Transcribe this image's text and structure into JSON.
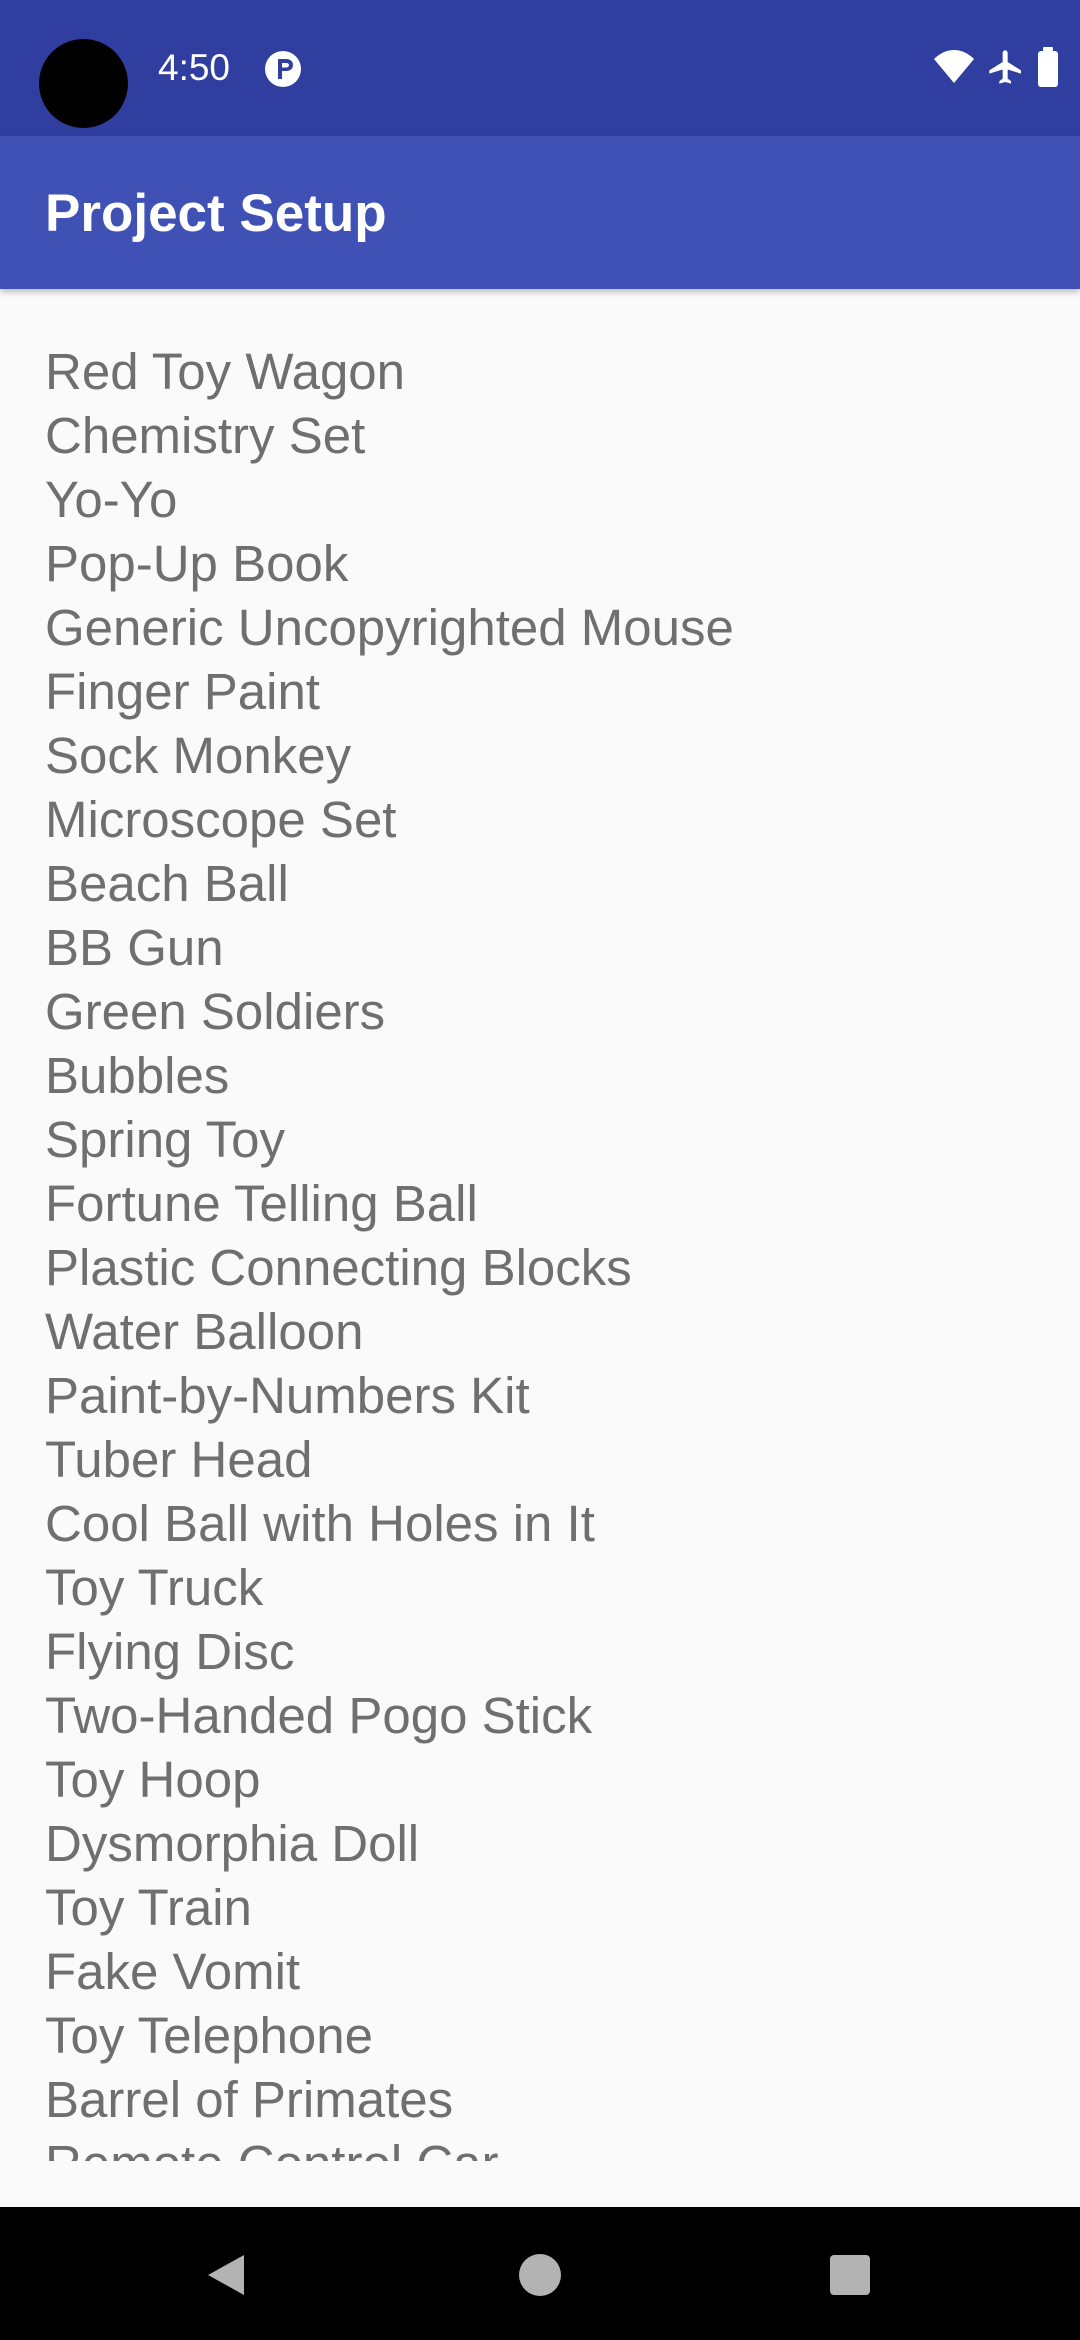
{
  "status_bar": {
    "time": "4:50",
    "icons": [
      "notification-icon",
      "wifi-icon",
      "airplane-mode-icon",
      "battery-icon"
    ],
    "background": "#303f9f"
  },
  "app_bar": {
    "title": "Project Setup",
    "background": "#3f51b5"
  },
  "list": {
    "items": [
      "Red Toy Wagon",
      "Chemistry Set",
      "Yo-Yo",
      "Pop-Up Book",
      "Generic Uncopyrighted Mouse",
      "Finger Paint",
      "Sock Monkey",
      "Microscope Set",
      "Beach Ball",
      "BB Gun",
      "Green Soldiers",
      "Bubbles",
      "Spring Toy",
      "Fortune Telling Ball",
      "Plastic Connecting Blocks",
      "Water Balloon",
      "Paint-by-Numbers Kit",
      "Tuber Head",
      "Cool Ball with Holes in It",
      "Toy Truck",
      "Flying Disc",
      "Two-Handed Pogo Stick",
      "Toy Hoop",
      "Dysmorphia Doll",
      "Toy Train",
      "Fake Vomit",
      "Toy Telephone",
      "Barrel of Primates",
      "Remote Control Car"
    ],
    "text_color": "#6f6f6f"
  },
  "nav_bar": {
    "buttons": [
      "back-icon",
      "home-icon",
      "recents-icon"
    ]
  }
}
